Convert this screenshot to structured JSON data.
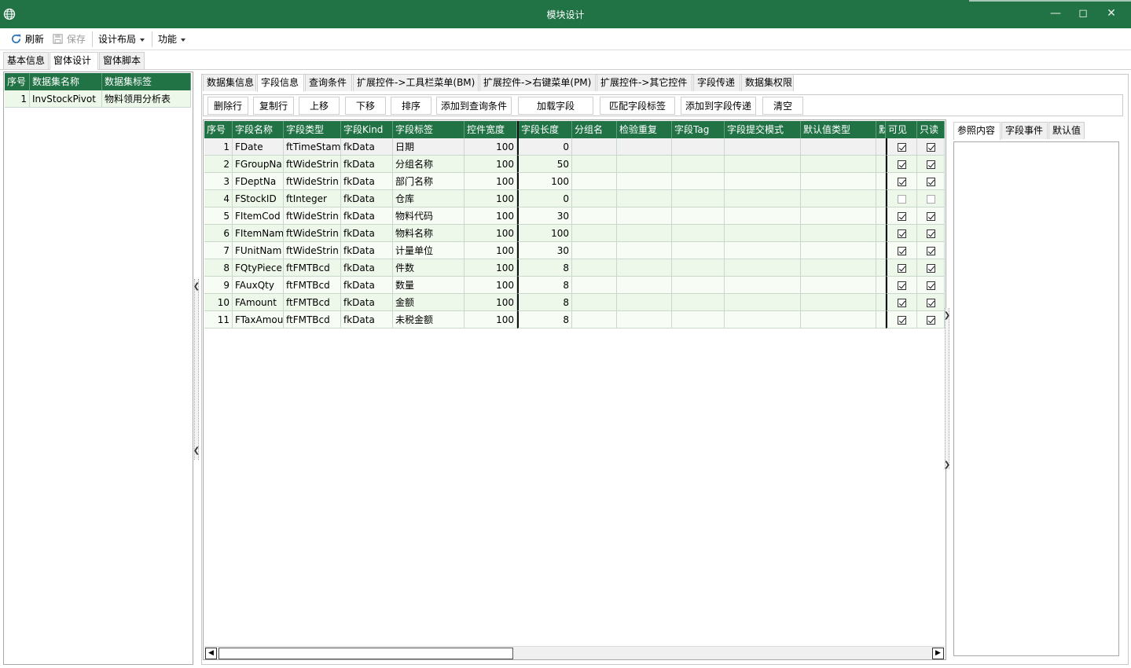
{
  "window": {
    "title": "模块设计",
    "controls": [
      "minimize-icon",
      "maximize-icon",
      "close-icon"
    ]
  },
  "toolbar": {
    "refresh": "刷新",
    "save": "保存",
    "design_layout": "设计布局",
    "functions": "功能"
  },
  "main_tabs": [
    "基本信息",
    "窗体设计",
    "窗体脚本"
  ],
  "datasets": {
    "columns": [
      "序号",
      "数据集名称",
      "数据集标签"
    ],
    "rows": [
      [
        "1",
        "InvStockPivot",
        "物料领用分析表"
      ]
    ]
  },
  "sub_tabs": [
    "数据集信息",
    "字段信息",
    "查询条件",
    "扩展控件->工具栏菜单(BM)",
    "扩展控件->右键菜单(PM)",
    "扩展控件->其它控件",
    "字段传递",
    "数据集权限"
  ],
  "buttons": [
    "删除行",
    "复制行",
    "上移",
    "下移",
    "排序",
    "添加到查询条件",
    "加载字段",
    "匹配字段标签",
    "添加到字段传递",
    "清空"
  ],
  "fields": {
    "columns": [
      "序号",
      "字段名称",
      "字段类型",
      "字段Kind",
      "字段标签",
      "控件宽度",
      "字段长度",
      "分组名",
      "检验重复",
      "字段Tag",
      "字段提交模式",
      "默认值类型",
      "默",
      "可见",
      "只读"
    ],
    "rows": [
      {
        "no": "1",
        "name": "FDate",
        "type": "ftTimeStam",
        "kind": "fkData",
        "label": "日期",
        "width": "100",
        "length": "0",
        "visible": true,
        "readonly": true
      },
      {
        "no": "2",
        "name": "FGroupNa",
        "type": "ftWideStrin",
        "kind": "fkData",
        "label": "分组名称",
        "width": "100",
        "length": "50",
        "visible": true,
        "readonly": true
      },
      {
        "no": "3",
        "name": "FDeptNa",
        "type": "ftWideStrin",
        "kind": "fkData",
        "label": "部门名称",
        "width": "100",
        "length": "100",
        "visible": true,
        "readonly": true
      },
      {
        "no": "4",
        "name": "FStockID",
        "type": "ftInteger",
        "kind": "fkData",
        "label": "仓库",
        "width": "100",
        "length": "0",
        "visible": false,
        "readonly": false
      },
      {
        "no": "5",
        "name": "FItemCod",
        "type": "ftWideStrin",
        "kind": "fkData",
        "label": "物料代码",
        "width": "100",
        "length": "30",
        "visible": true,
        "readonly": true
      },
      {
        "no": "6",
        "name": "FItemNam",
        "type": "ftWideStrin",
        "kind": "fkData",
        "label": "物料名称",
        "width": "100",
        "length": "100",
        "visible": true,
        "readonly": true
      },
      {
        "no": "7",
        "name": "FUnitNam",
        "type": "ftWideStrin",
        "kind": "fkData",
        "label": "计量单位",
        "width": "100",
        "length": "30",
        "visible": true,
        "readonly": true
      },
      {
        "no": "8",
        "name": "FQtyPiece",
        "type": "ftFMTBcd",
        "kind": "fkData",
        "label": "件数",
        "width": "100",
        "length": "8",
        "visible": true,
        "readonly": true
      },
      {
        "no": "9",
        "name": "FAuxQty",
        "type": "ftFMTBcd",
        "kind": "fkData",
        "label": "数量",
        "width": "100",
        "length": "8",
        "visible": true,
        "readonly": true
      },
      {
        "no": "10",
        "name": "FAmount",
        "type": "ftFMTBcd",
        "kind": "fkData",
        "label": "金额",
        "width": "100",
        "length": "8",
        "visible": true,
        "readonly": true
      },
      {
        "no": "11",
        "name": "FTaxAmou",
        "type": "ftFMTBcd",
        "kind": "fkData",
        "label": "未税金额",
        "width": "100",
        "length": "8",
        "visible": true,
        "readonly": true
      }
    ]
  },
  "prop_tabs": [
    "参照内容",
    "字段事件",
    "默认值"
  ],
  "colors": {
    "accent": "#217346",
    "row_odd": "#eef8ea",
    "row_even": "#f7fcf5"
  }
}
